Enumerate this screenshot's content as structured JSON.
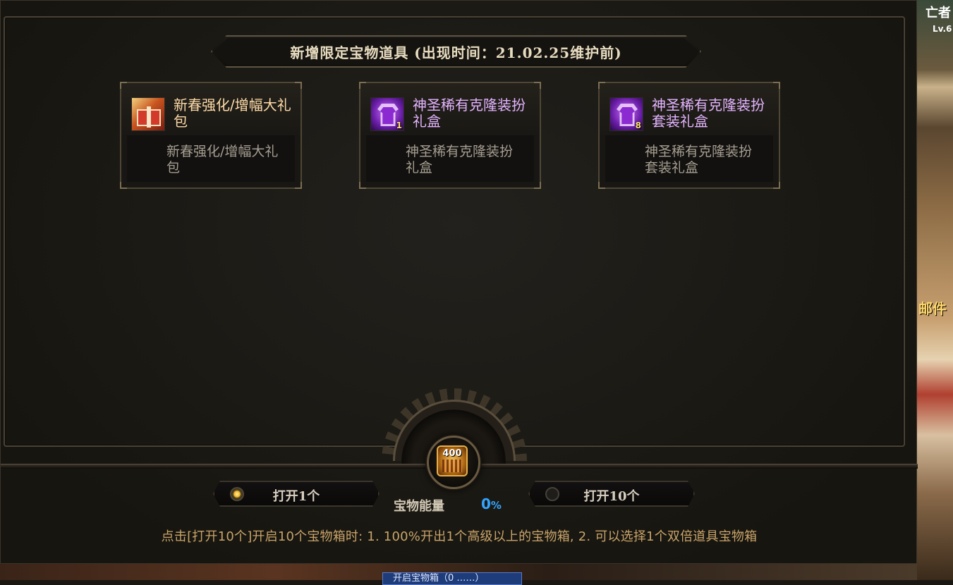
{
  "banner": {
    "title": "新增限定宝物道具 (出现时间：21.02.25维护前)"
  },
  "items": [
    {
      "name": "新春强化/增幅大礼包",
      "desc": "新春强化/增幅大礼包",
      "icon": "gift-box-icon",
      "qty": "",
      "name_color": "#ffdca8"
    },
    {
      "name": "神圣稀有克隆装扮礼盒",
      "desc": "神圣稀有克隆装扮礼盒",
      "icon": "costume-shirt-icon",
      "qty": "1",
      "name_color": "#e3b4ff"
    },
    {
      "name": "神圣稀有克隆装扮套装礼盒",
      "desc": "神圣稀有克隆装扮套装礼盒",
      "icon": "costume-shirt-icon",
      "qty": "8",
      "name_color": "#e3b4ff"
    }
  ],
  "controls": {
    "open_one": {
      "label": "打开1个",
      "selected": true
    },
    "open_ten": {
      "label": "打开10个",
      "selected": false
    },
    "energy_label": "宝物能量",
    "energy_value": "0",
    "energy_unit": "%",
    "coin_value": "400"
  },
  "hint": "点击[打开10个]开启10个宝物箱时: 1. 100%开出1个高级以上的宝物箱, 2. 可以选择1个双倍道具宝物箱",
  "background": {
    "right_top_text": "亡者",
    "right_level": "Lv.6",
    "right_mid_text": "邮件",
    "taskbar_text": "开启宝物箱（0 ……）"
  },
  "colors": {
    "gold_text": "#ffdca8",
    "purple_text": "#e3b4ff",
    "energy_blue": "#33a4ff",
    "hint_text": "#c9a46a"
  }
}
